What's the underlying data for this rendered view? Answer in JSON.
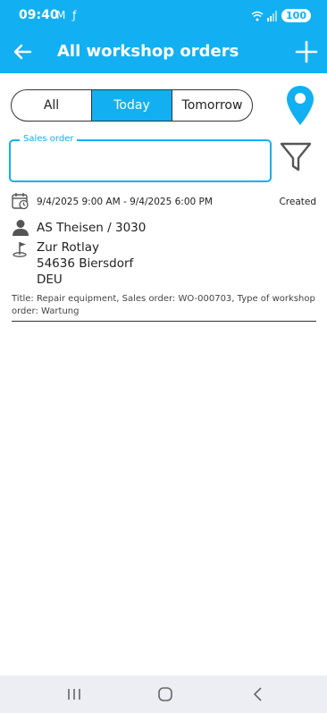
{
  "status_bar": {
    "time": "09:40",
    "left_icons": "M ƒ",
    "battery": "100"
  },
  "app_bar": {
    "title": "All workshop orders"
  },
  "filter_tabs": [
    "All",
    "Today",
    "Tomorrow"
  ],
  "selected_tab": "Today",
  "sales_order_field": {
    "label": "Sales order",
    "value": ""
  },
  "orders": [
    {
      "date_range": "9/4/2025 9:00 AM - 9/4/2025 6:00 PM",
      "status": "Created",
      "customer": "AS Theisen / 3030",
      "address_lines": [
        "Zur Rotlay",
        "54636 Biersdorf",
        "DEU"
      ],
      "description": "Title: Repair equipment, Sales order: WO-000703, Type of workshop order: Wartung"
    }
  ],
  "colors": {
    "accent": "#12b0f2",
    "nav_bar": "#eceef3"
  },
  "icons": {
    "back": "arrow-left-icon",
    "add": "plus-icon",
    "map": "map-pin-icon",
    "filter": "funnel-icon",
    "calendar": "calendar-clock-icon",
    "customer": "person-icon",
    "address": "flag-location-icon"
  }
}
